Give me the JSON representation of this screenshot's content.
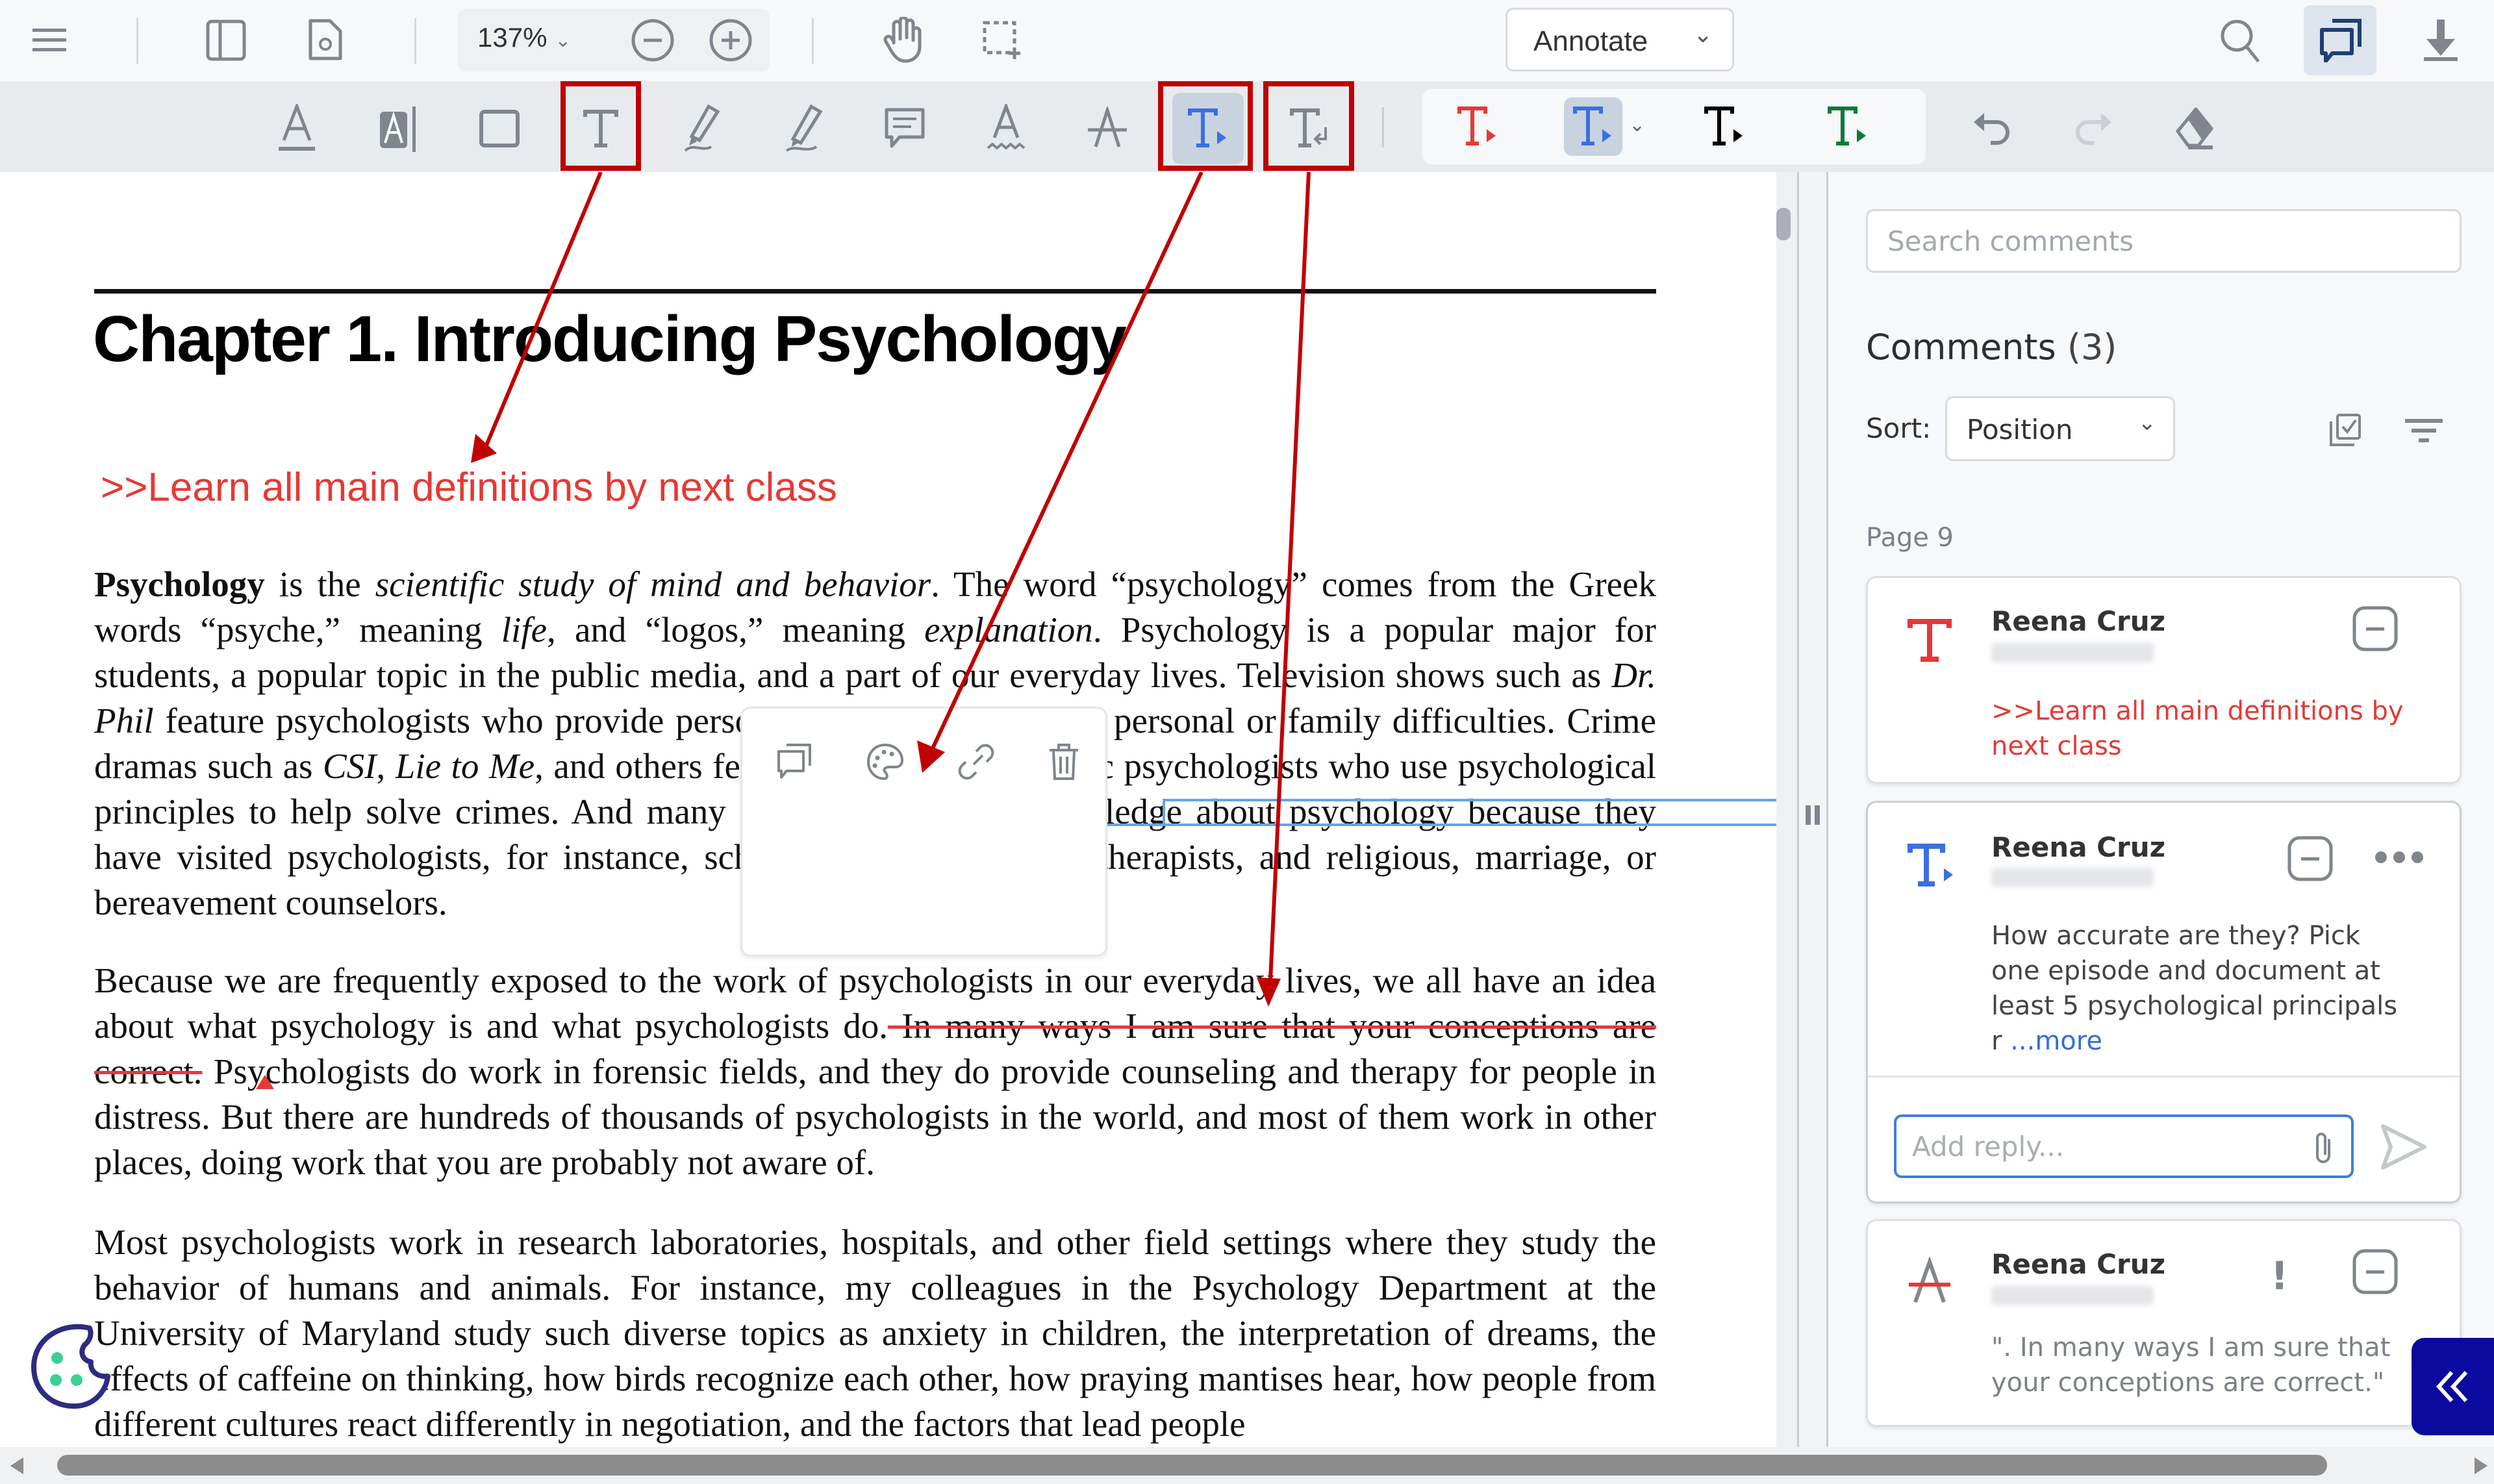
{
  "top_toolbar": {
    "menu_icon": "hamburger-menu-icon",
    "zoom_value": "137%",
    "mode_select": "Annotate"
  },
  "document": {
    "chapter_title": "Chapter 1. Introducing Psychology",
    "free_text_annotation": ">>Learn all main definitions by next class",
    "paragraph1": {
      "bold_lead": "Psychology",
      "t1": " is the ",
      "i1": "scientific study of mind and behavior",
      "t2": ". The word “psychology” comes from the Greek words “psyche,” meaning ",
      "i2": "life",
      "t3": ", and “logos,” meaning ",
      "i3": "explanation",
      "t4": ". Psychology is a popular major for students, a popular topic in the public media, and a part of our everyday lives. Television shows such as ",
      "i4": "Dr. Phil",
      "t5": " feature psychologists who provide personal advice to those with personal or family difficulties. Crime dramas such as ",
      "i5": "CSI",
      "t6": ", ",
      "i6": "Lie to Me",
      "t7": ", and others feature the work of forensic psychologists who use psychological principles to help solve crimes. And many people have direct knowledge about psychology because they have visited psychologists, for instance, school counselors, family therapists, and religious, marriage, or bereavement counselors."
    },
    "paragraph2": {
      "t1": "Because we are frequently exposed to the work of psychologists in our everyday lives, we all have an idea about what psychology is and what psychologists do.",
      "struck": " In many ways I am sure that your conceptions are correct.",
      "t2": " Psychologists do work in forensic fields, and they do provide counseling and therapy for people in distress. But there are hundreds of thousands of psychologists in the world, and most of them work in other places, doing work that you are probably not aware of."
    },
    "paragraph3": "Most psychologists work in research laboratories, hospitals, and other field settings where they study the behavior of humans and animals. For instance, my colleagues in the Psychology Department at the University of Maryland study such diverse topics as anxiety in children, the interpretation of dreams, the effects of caffeine on thinking, how birds recognize each other, how praying mantises hear, how people from different cultures react differently in negotiation, and the factors that lead people"
  },
  "annotation_popup": {
    "actions": [
      "comment-icon",
      "palette-icon",
      "link-icon",
      "trash-icon"
    ]
  },
  "comments_panel": {
    "search_placeholder": "Search comments",
    "title": "Comments",
    "count": "(3)",
    "sort_label": "Sort:",
    "sort_value": "Position",
    "page_label": "Page 9",
    "comments": [
      {
        "type": "free-text",
        "author": "Reena Cruz",
        "body": ">>Learn all main definitions by next class",
        "color": "#e53935"
      },
      {
        "type": "text-insert",
        "author": "Reena Cruz",
        "body": "How accurate are they? Pick one episode and document at least 5 psychological principals r ",
        "more": "...more",
        "reply_placeholder": "Add reply..."
      },
      {
        "type": "strikeout",
        "author": "Reena Cruz",
        "body": "\". In many ways I am sure that your conceptions are correct.\"",
        "priority": "!"
      }
    ]
  },
  "colors": {
    "accent_blue": "#3b6fe0",
    "annotation_red": "#e53935",
    "callout_red": "#c00000",
    "text_green": "#0a7a36",
    "panel_collapse": "#0a0a9e"
  }
}
